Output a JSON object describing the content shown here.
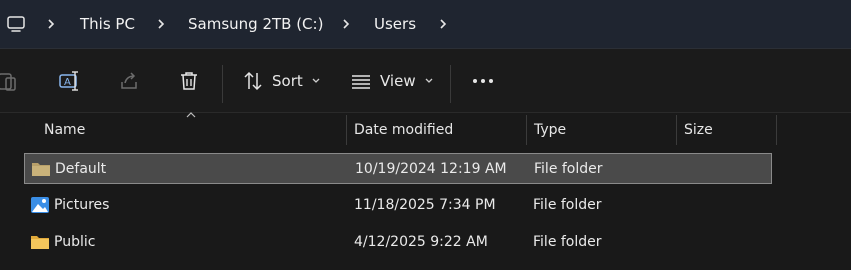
{
  "addressbar": {
    "breadcrumbs": [
      {
        "label": "This PC"
      },
      {
        "label": "Samsung 2TB (C:)"
      },
      {
        "label": "Users"
      }
    ],
    "icons": {
      "root": "computer-icon",
      "separator": "chevron-right-icon"
    }
  },
  "toolbar": {
    "items": [
      {
        "name": "paste",
        "icon": "paste-icon"
      },
      {
        "name": "rename",
        "icon": "rename-icon"
      },
      {
        "name": "share",
        "icon": "share-icon"
      },
      {
        "name": "delete",
        "icon": "trash-icon"
      }
    ],
    "sort_label": "Sort",
    "view_label": "View",
    "more_icon": "more-horizontal-icon"
  },
  "list": {
    "columns": [
      "Name",
      "Date modified",
      "Type",
      "Size"
    ],
    "sorted_by": "Name",
    "rows": [
      {
        "name": "Default",
        "date_modified": "10/19/2024 12:19 AM",
        "type": "File folder",
        "icon": "folder-icon",
        "selected": true
      },
      {
        "name": "Pictures",
        "date_modified": "11/18/2025 7:34 PM",
        "type": "File folder",
        "icon": "pictures-folder-icon",
        "selected": false
      },
      {
        "name": "Public",
        "date_modified": "4/12/2025 9:22 AM",
        "type": "File folder",
        "icon": "folder-icon",
        "selected": false
      }
    ]
  },
  "colors": {
    "addressbar_bg": "#1f2530",
    "app_bg": "#191919",
    "selection_bg": "#4a4a4a",
    "folder_yellow": "#f2c55c",
    "pictures_blue": "#3a8ee6"
  }
}
